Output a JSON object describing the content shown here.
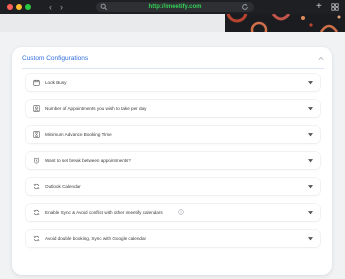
{
  "browser": {
    "url": "http://imeetify.com"
  },
  "panel": {
    "title": "Custom Configurations",
    "rows": [
      {
        "label": "Look Busy",
        "icon": "calendar-icon"
      },
      {
        "label": "Number of Appointments you wish to take per day",
        "icon": "person-icon"
      },
      {
        "label": "Minimum Advance Booking Time",
        "icon": "hourglass-icon"
      },
      {
        "label": "Want to set break between appointments?",
        "icon": "alarm-icon"
      },
      {
        "label": "Outlook Calendar",
        "icon": "sync-icon"
      },
      {
        "label": "Enable Sync & Avoid conflict with other imeetify calendars",
        "icon": "sync-icon"
      },
      {
        "label": "Avoid double booking, Sync with Google calendar",
        "icon": "sync-icon"
      }
    ]
  },
  "colors": {
    "accent": "#2f6fde",
    "url_text": "#34d058",
    "browser_bar": "#1e1f22"
  }
}
